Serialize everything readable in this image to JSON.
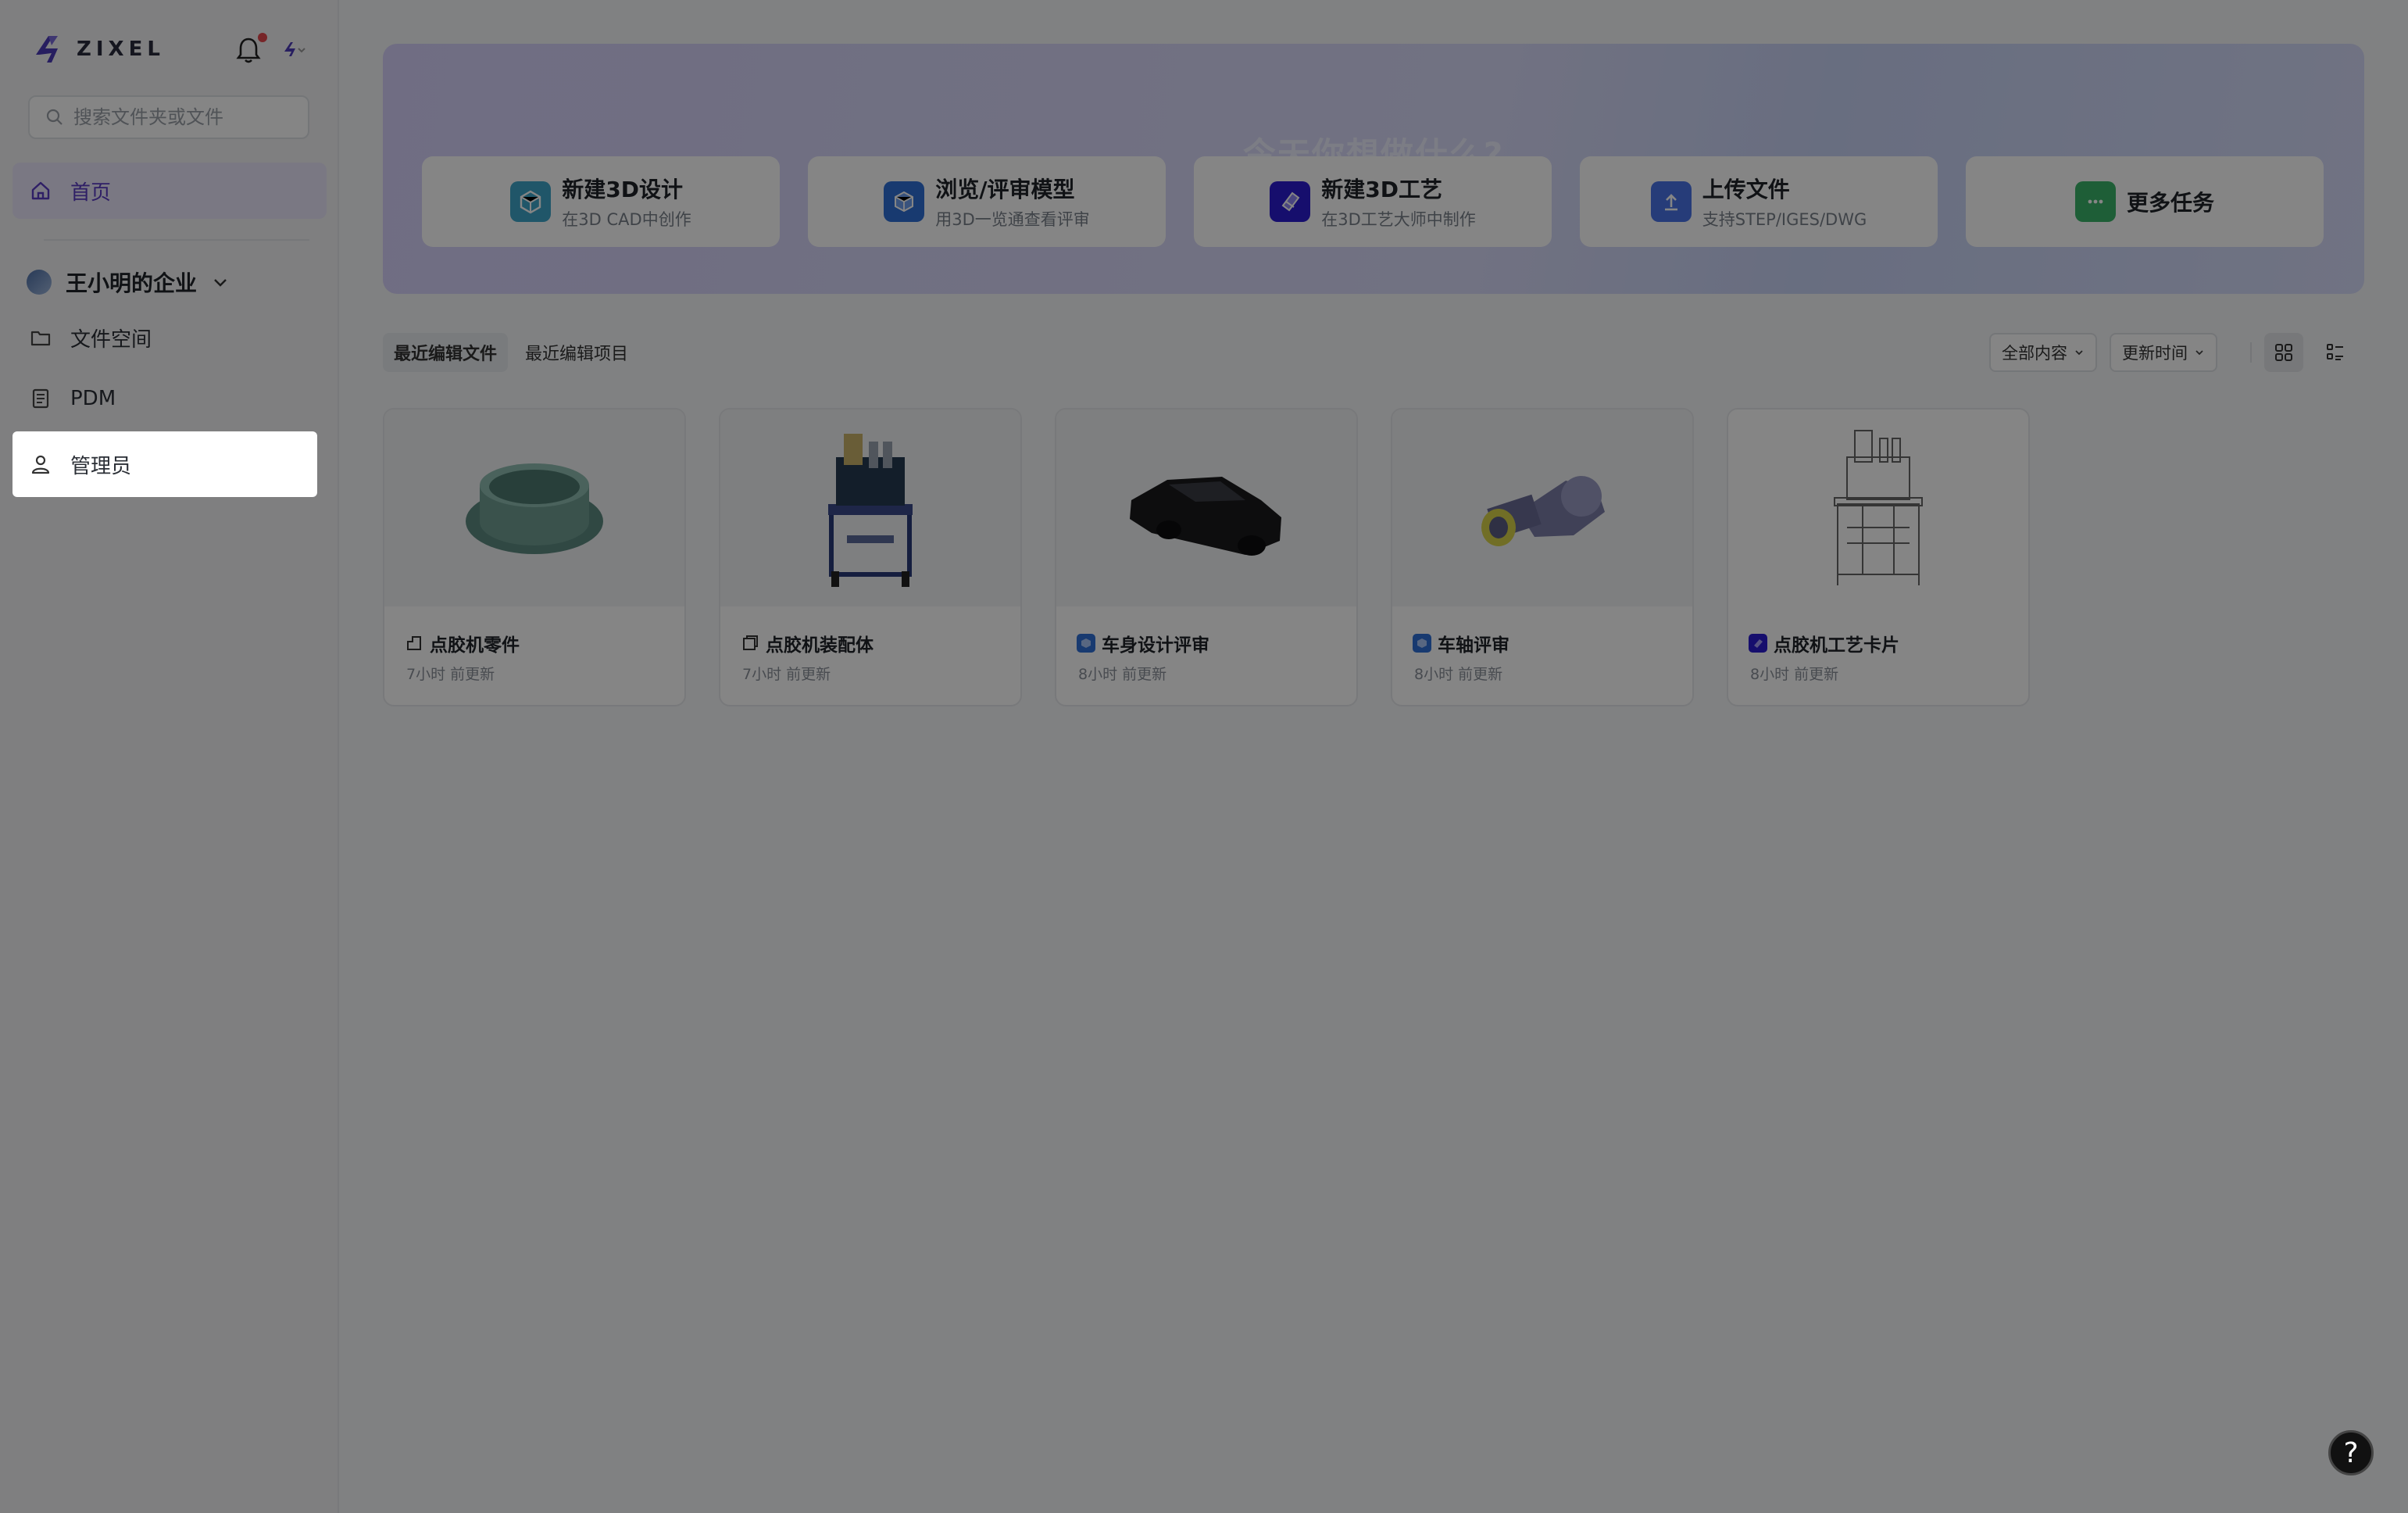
{
  "app": {
    "logo_text": "ZIXEL"
  },
  "sidebar": {
    "search_placeholder": "搜索文件夹或文件",
    "home_label": "首页",
    "org_name": "王小明的企业",
    "items": [
      {
        "label": "文件空间"
      },
      {
        "label": "PDM"
      },
      {
        "label": "管理员"
      }
    ]
  },
  "banner": {
    "title": "今天你想做什么?",
    "cards": [
      {
        "title": "新建3D设计",
        "subtitle": "在3D CAD中创作",
        "color": "#3fa6c9"
      },
      {
        "title": "浏览/评审模型",
        "subtitle": "用3D一览通查看评审",
        "color": "#2f6fd6"
      },
      {
        "title": "新建3D工艺",
        "subtitle": "在3D工艺大师中制作",
        "color": "#2b1bd1"
      },
      {
        "title": "上传文件",
        "subtitle": "支持STEP/IGES/DWG",
        "color": "#4a74e8"
      },
      {
        "title": "更多任务",
        "subtitle": "",
        "color": "#3bb46a"
      }
    ]
  },
  "tabs": {
    "recent_files": "最近编辑文件",
    "recent_projects": "最近编辑项目"
  },
  "filters": {
    "content": "全部内容",
    "sort": "更新时间"
  },
  "files": [
    {
      "name": "点胶机零件",
      "time": "7小时 前更新",
      "icon": "part-icon"
    },
    {
      "name": "点胶机装配体",
      "time": "7小时 前更新",
      "icon": "assembly-icon"
    },
    {
      "name": "车身设计评审",
      "time": "8小时 前更新",
      "icon": "review-icon"
    },
    {
      "name": "车轴评审",
      "time": "8小时 前更新",
      "icon": "review-icon"
    },
    {
      "name": "点胶机工艺卡片",
      "time": "8小时 前更新",
      "icon": "process-icon"
    }
  ],
  "help": {
    "label": "?"
  }
}
